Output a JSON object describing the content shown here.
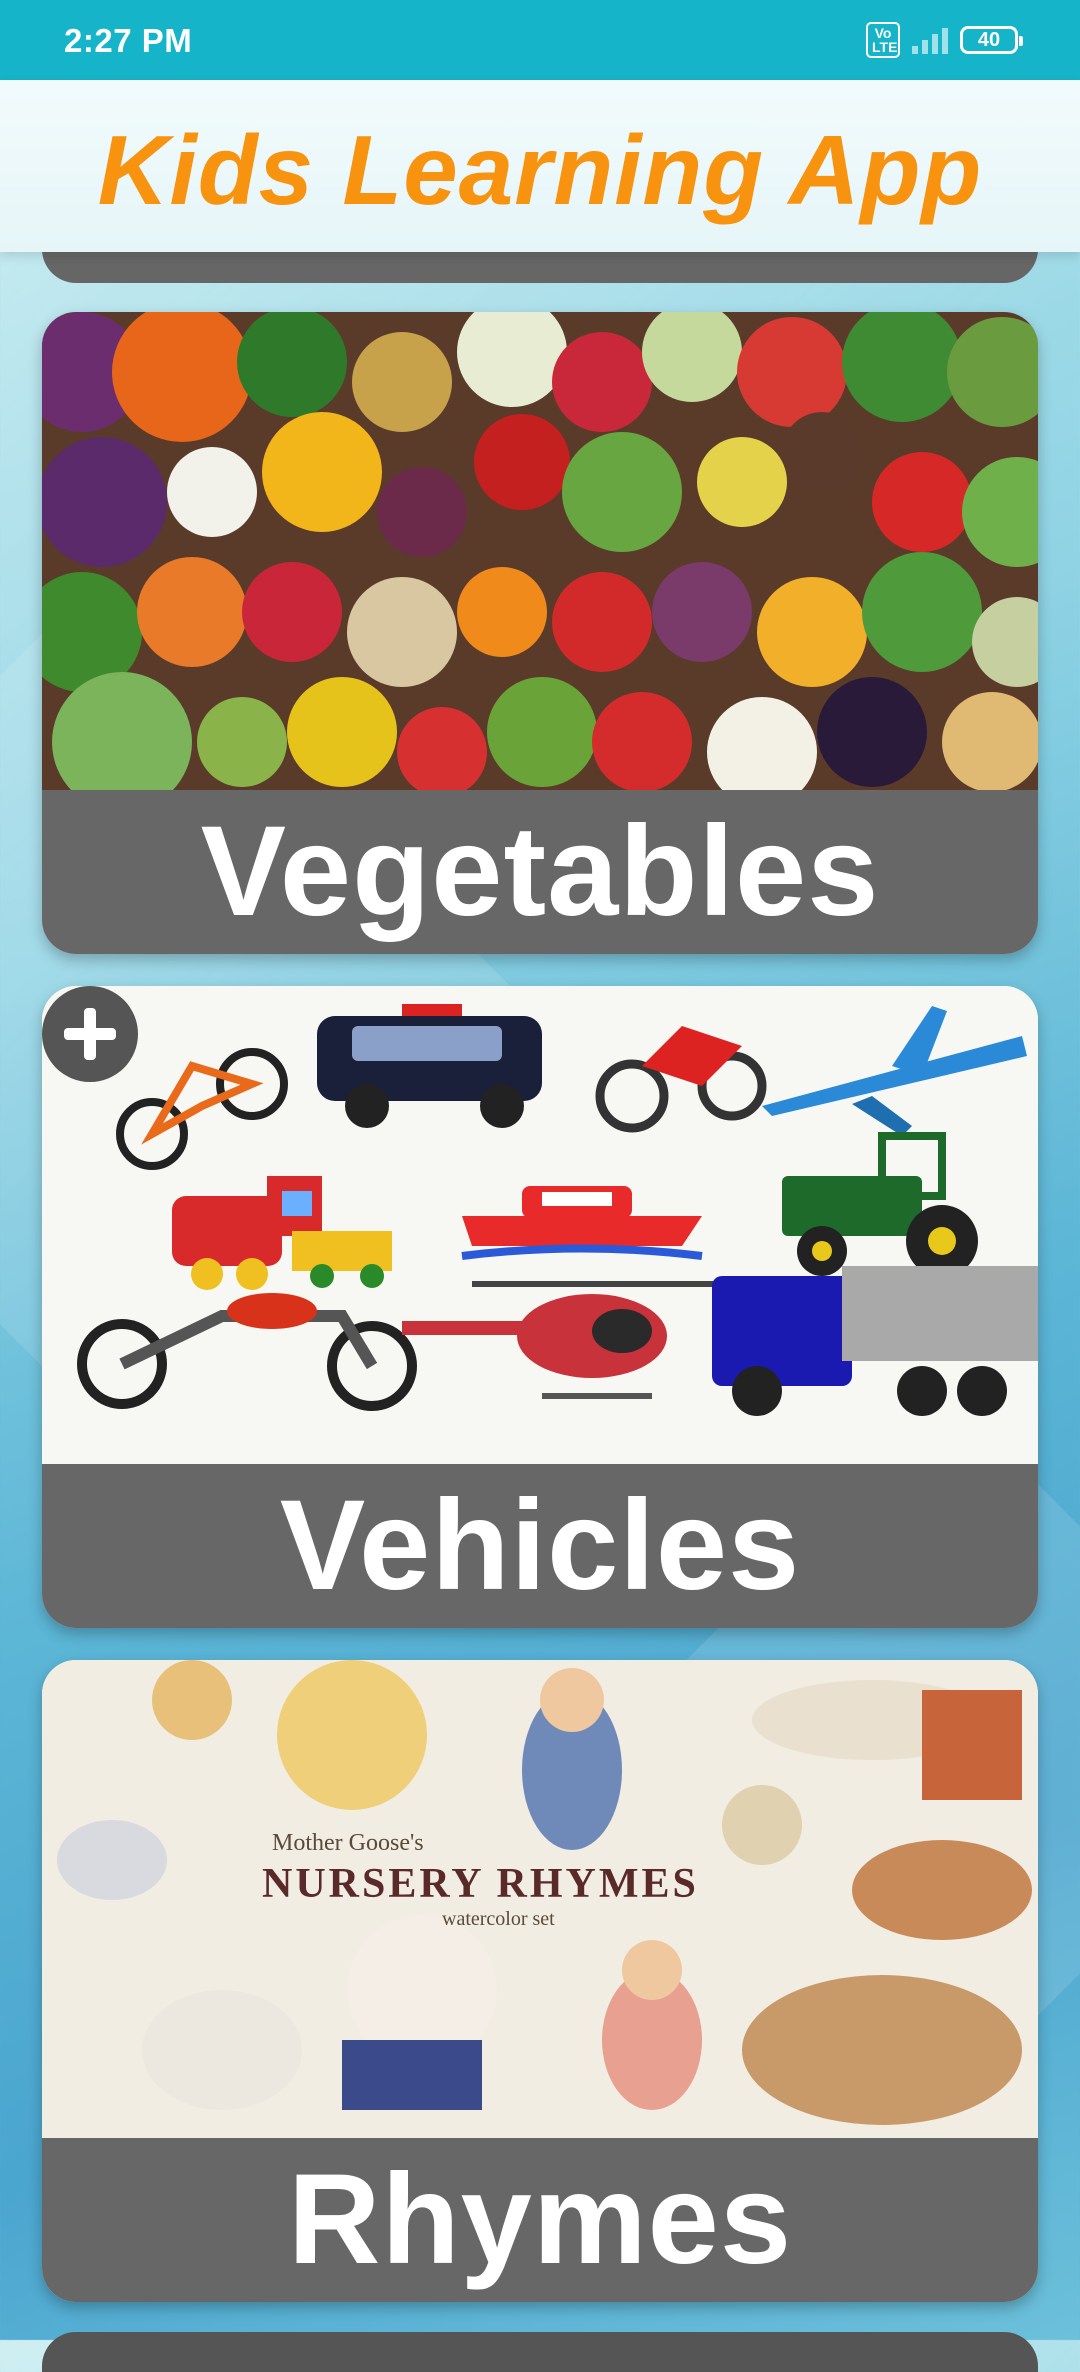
{
  "status_bar": {
    "time": "2:27 PM",
    "volte_label": "Vo LTE",
    "battery_level": "40"
  },
  "header": {
    "title": "Kids Learning App"
  },
  "categories": [
    {
      "label": "Vegetables",
      "image_icon": "vegetables-image"
    },
    {
      "label": "Vehicles",
      "image_icon": "vehicles-image"
    },
    {
      "label": "Rhymes",
      "image_icon": "nursery-rhymes-image"
    }
  ],
  "rhymes_image": {
    "line1": "Mother Goose's",
    "line2": "NURSERY RHYMES",
    "line3": "watercolor set"
  },
  "colors": {
    "status_bar": "#16b4c8",
    "title": "#f7930e",
    "card_label_bg": "#676767"
  }
}
